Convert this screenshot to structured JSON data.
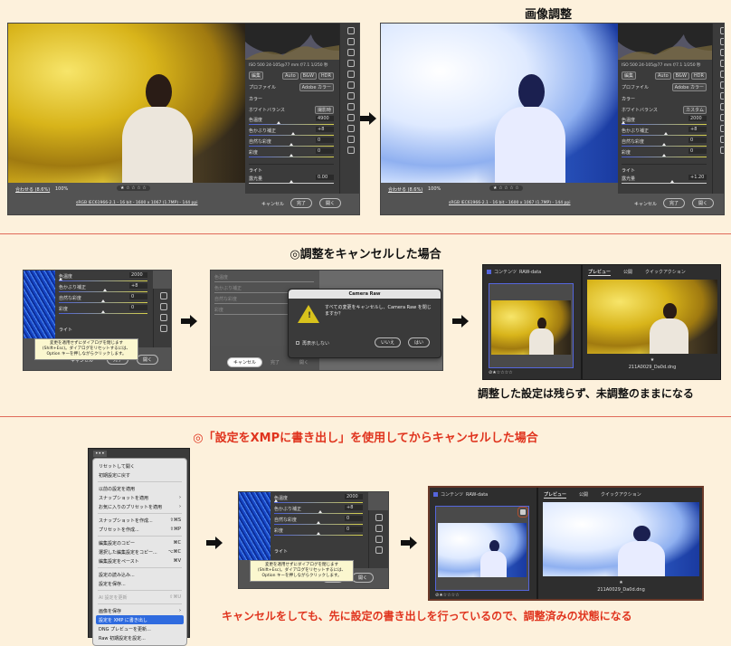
{
  "section1": {
    "title": "画像調整"
  },
  "ui": {
    "exif": "ISO 500   24-105@77 mm   f/7.1   1/250 秒",
    "edit_tab": "編集",
    "auto": "Auto",
    "bw": "B&W",
    "hdr": "HDR",
    "profile_label": "プロファイル",
    "profile_value": "Adobe カラー",
    "color_section": "カラー",
    "wb_label": "ホワイトバランス",
    "light_section": "ライト",
    "zoom_fit": "合わせる (8.6%)",
    "zoom_pct": "100%",
    "file_info": "sRGB IEC61966-2.1 - 16 bit - 1600 x 1067 (1.7MP) - 144 ppi",
    "cancel": "キャンセル",
    "done": "完了",
    "open": "開く",
    "stars": "★ ☆ ☆ ☆ ☆",
    "tooltip": "変更を適用せずにダイアログを閉じます (Shift+Esc)。ダイアログをリセットするには、Option キーを押しながらクリックします。"
  },
  "before": {
    "wb_value": "撮影時",
    "sliders": [
      {
        "label": "色温度",
        "value": "4900",
        "pos": 0.35
      },
      {
        "label": "色かぶり補正",
        "value": "+8",
        "pos": 0.52
      },
      {
        "label": "自然な彩度",
        "value": "0",
        "pos": 0.5
      },
      {
        "label": "彩度",
        "value": "0",
        "pos": 0.5
      }
    ],
    "exposure": {
      "label": "露光量",
      "value": "0.00",
      "pos": 0.5
    }
  },
  "after": {
    "wb_value": "カスタム",
    "sliders": [
      {
        "label": "色温度",
        "value": "2000",
        "pos": 0.02
      },
      {
        "label": "色かぶり補正",
        "value": "+8",
        "pos": 0.52
      },
      {
        "label": "自然な彩度",
        "value": "0",
        "pos": 0.5
      },
      {
        "label": "彩度",
        "value": "0",
        "pos": 0.5
      }
    ],
    "exposure": {
      "label": "露光量",
      "value": "+1.20",
      "pos": 0.6
    }
  },
  "section2": {
    "heading": "◎調整をキャンセルした場合",
    "dialog": {
      "title": "Camera Raw",
      "message": "すべての変更をキャンセルし、Camera Raw を閉じますか？",
      "checkbox": "再表示しない",
      "no": "いいえ",
      "yes": "はい"
    },
    "caption": "調整した設定は残らず、未調整のままになる"
  },
  "library": {
    "content_tab": "コンテンツ",
    "folder": "RAW-data",
    "preview_tab": "プレビュー",
    "publish_tab": "公開",
    "quick_tab": "クイックアクション",
    "rating": "⊘★☆☆☆☆",
    "star": "★",
    "filename": "211A0029_Da0d.dng"
  },
  "section3": {
    "heading": "◎「設定をXMPに書き出し」を使用してからキャンセルした場合",
    "caption": "キャンセルをしても、先に設定の書き出しを行っているので、調整済みの状態になる",
    "menu_button": "•••",
    "menu": [
      {
        "label": "リセットして開く",
        "shortcut": ""
      },
      {
        "label": "初期設定に戻す",
        "shortcut": ""
      },
      {
        "sep": true
      },
      {
        "label": "以前の設定を適用",
        "shortcut": ""
      },
      {
        "label": "スナップショットを適用",
        "shortcut": "›"
      },
      {
        "label": "お気に入りのプリセットを適用",
        "shortcut": "›"
      },
      {
        "sep": true
      },
      {
        "label": "スナップショットを作成...",
        "shortcut": "⇧⌘S"
      },
      {
        "label": "プリセットを作成...",
        "shortcut": "⇧⌘P"
      },
      {
        "sep": true
      },
      {
        "label": "編集設定のコピー",
        "shortcut": "⌘C"
      },
      {
        "label": "選択した編集設定をコピー...",
        "shortcut": "⌥⌘C"
      },
      {
        "label": "編集設定をペースト",
        "shortcut": "⌘V"
      },
      {
        "sep": true
      },
      {
        "label": "設定の読み込み...",
        "shortcut": ""
      },
      {
        "label": "設定を保存...",
        "shortcut": ""
      },
      {
        "sep": true
      },
      {
        "label": "AI 設定を更新",
        "shortcut": "⇧⌘U",
        "disabled": true
      },
      {
        "sep": true
      },
      {
        "label": "画像を保存",
        "shortcut": "›"
      },
      {
        "label": "設定を XMP に書き出し",
        "shortcut": "",
        "highlighted": true
      },
      {
        "label": "DNG プレビューを更新...",
        "shortcut": ""
      },
      {
        "label": "Raw 初期設定を設定...",
        "shortcut": ""
      }
    ]
  },
  "colors": {
    "accent_red": "#e0341e",
    "rule": "#e06a5a",
    "menu_highlight": "#2f6bdf",
    "page_bg": "#fdf1dc"
  }
}
